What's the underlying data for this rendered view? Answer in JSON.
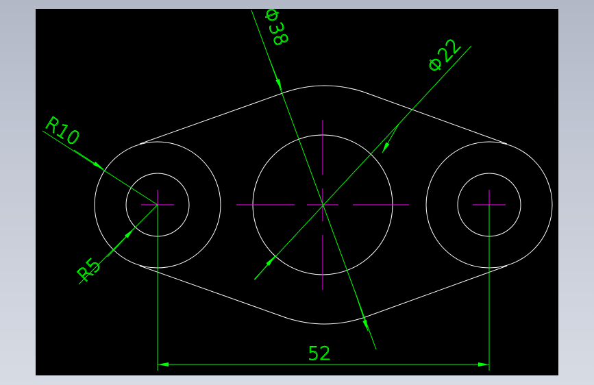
{
  "drawing": {
    "colors": {
      "background": "#000000",
      "geometry": "#ffffff",
      "dimension": "#00ff00",
      "centerline": "#ff00ff"
    },
    "dimensions": {
      "dia38": "Φ38",
      "dia22": "Φ22",
      "r10": "R10",
      "r5": "R5",
      "len52": "52"
    }
  }
}
